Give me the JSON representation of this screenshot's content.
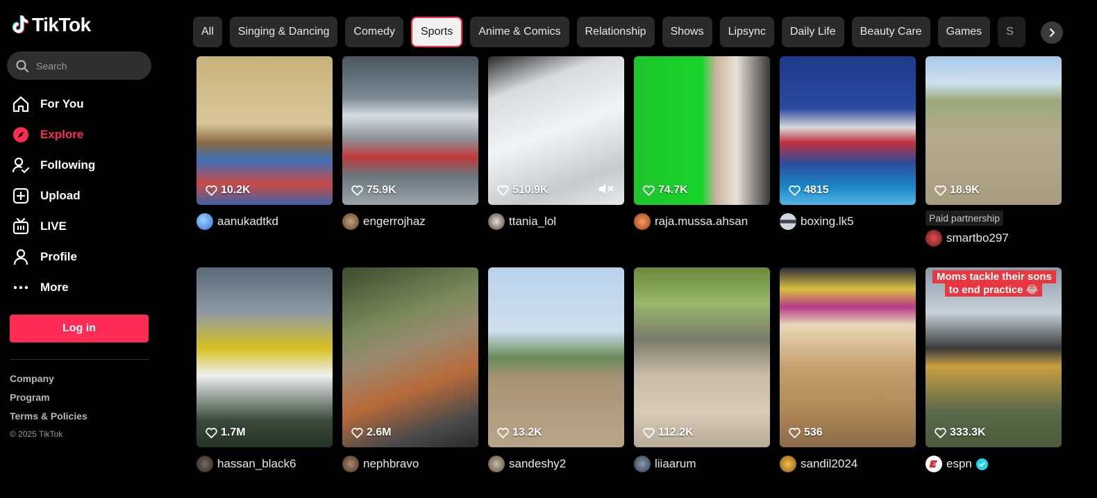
{
  "app": {
    "name": "TikTok"
  },
  "search": {
    "placeholder": "Search"
  },
  "nav": [
    {
      "label": "For You",
      "icon": "home-icon"
    },
    {
      "label": "Explore",
      "icon": "compass-icon",
      "active": true
    },
    {
      "label": "Following",
      "icon": "following-icon"
    },
    {
      "label": "Upload",
      "icon": "upload-icon"
    },
    {
      "label": "LIVE",
      "icon": "live-tv-icon"
    },
    {
      "label": "Profile",
      "icon": "person-icon"
    },
    {
      "label": "More",
      "icon": "more-dots-icon"
    }
  ],
  "login": {
    "label": "Log in"
  },
  "footer": {
    "links": [
      "Company",
      "Program",
      "Terms & Policies"
    ],
    "copyright": "© 2025 TikTok"
  },
  "categories": [
    "All",
    "Singing & Dancing",
    "Comedy",
    "Sports",
    "Anime & Comics",
    "Relationship",
    "Shows",
    "Lipsync",
    "Daily Life",
    "Beauty Care",
    "Games",
    "S"
  ],
  "active_category": "Sports",
  "colors": {
    "accent": "#fe2c55",
    "background": "#000000",
    "verified": "#20d5ec"
  },
  "videos_row1": [
    {
      "likes": "10.2K",
      "user": "aanukadtkd"
    },
    {
      "likes": "75.9K",
      "user": "engerrojhaz"
    },
    {
      "likes": "510.9K",
      "user": "ttania_lol",
      "muted": true
    },
    {
      "likes": "74.7K",
      "user": "raja.mussa.ahsan"
    },
    {
      "likes": "4815",
      "user": "boxing.lk5"
    },
    {
      "likes": "18.9K",
      "user": "smartbo297",
      "paid_label": "Paid partnership"
    }
  ],
  "videos_row2": [
    {
      "likes": "1.7M",
      "user": "hassan_black6"
    },
    {
      "likes": "2.6M",
      "user": "nephbravo"
    },
    {
      "likes": "13.2K",
      "user": "sandeshy2"
    },
    {
      "likes": "112.2K",
      "user": "liiaarum"
    },
    {
      "likes": "536",
      "user": "sandil2024"
    },
    {
      "likes": "333.3K",
      "user": "espn",
      "verified": true,
      "caption": "Moms tackle their sons to end practice 😂"
    }
  ]
}
